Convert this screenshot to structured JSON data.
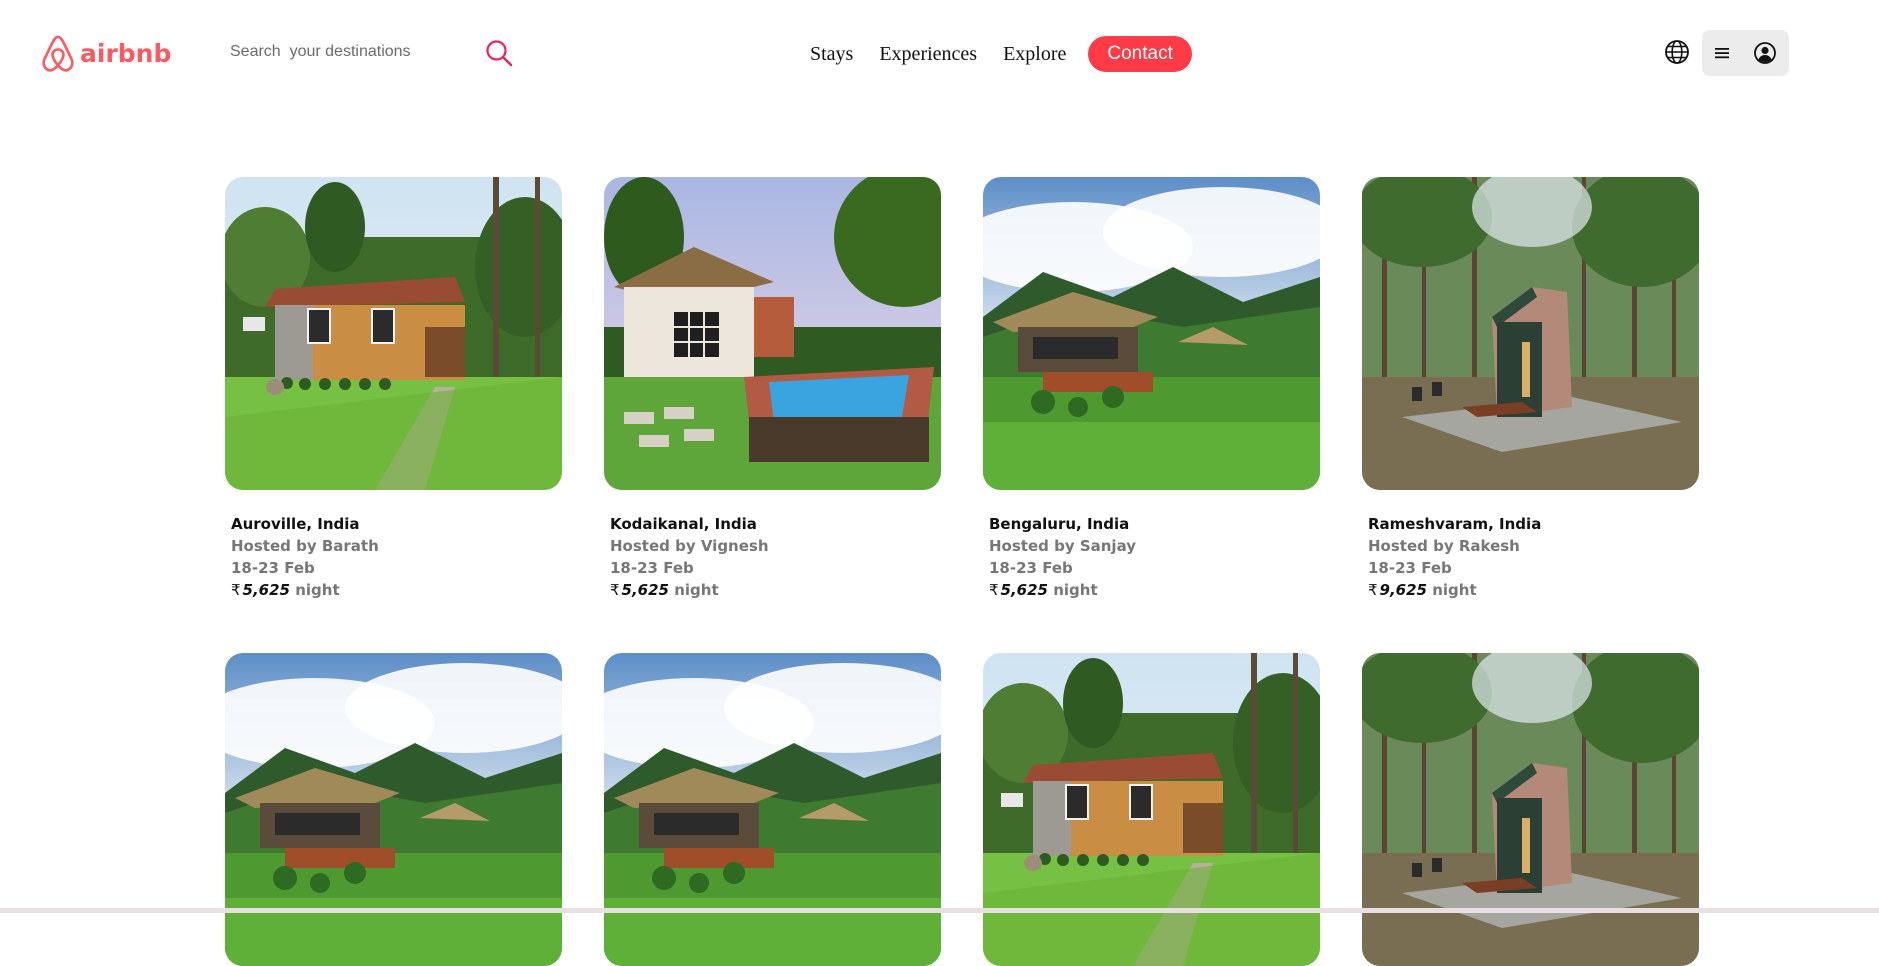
{
  "brand": {
    "name": "airbnb",
    "color": "#FF5A5F"
  },
  "search": {
    "placeholder": "Search  your destinations",
    "value": ""
  },
  "nav": {
    "links": [
      "Stays",
      "Experiences",
      "Explore"
    ],
    "contact_label": "Contact",
    "contact_color": "#FF3B47"
  },
  "icons": {
    "search": "magnifier-icon",
    "globe": "globe-icon",
    "menu": "hamburger-icon",
    "user": "user-circle-icon"
  },
  "currency": "₹",
  "listings": [
    {
      "location": "Auroville, India",
      "host": "Hosted by Barath",
      "dates": "18-23 Feb",
      "price": "5,625",
      "unit": "night",
      "photo": "tiled-roof-cabin"
    },
    {
      "location": "Kodaikanal, India",
      "host": "Hosted by Vignesh",
      "dates": "18-23 Feb",
      "price": "5,625",
      "unit": "night",
      "photo": "cottage-with-pool"
    },
    {
      "location": "Bengaluru, India",
      "host": "Hosted by Sanjay",
      "dates": "18-23 Feb",
      "price": "5,625",
      "unit": "night",
      "photo": "thatched-hut-mountains"
    },
    {
      "location": "Rameshvaram, India",
      "host": "Hosted by Rakesh",
      "dates": "18-23 Feb",
      "price": "9,625",
      "unit": "night",
      "photo": "a-frame-forest-cabin"
    },
    {
      "location": "",
      "host": "",
      "dates": "",
      "price": "",
      "unit": "",
      "photo": "thatched-hut-mountains"
    },
    {
      "location": "",
      "host": "",
      "dates": "",
      "price": "",
      "unit": "",
      "photo": "thatched-hut-mountains"
    },
    {
      "location": "",
      "host": "",
      "dates": "",
      "price": "",
      "unit": "",
      "photo": "tiled-roof-cabin"
    },
    {
      "location": "",
      "host": "",
      "dates": "",
      "price": "",
      "unit": "",
      "photo": "a-frame-forest-cabin"
    }
  ]
}
